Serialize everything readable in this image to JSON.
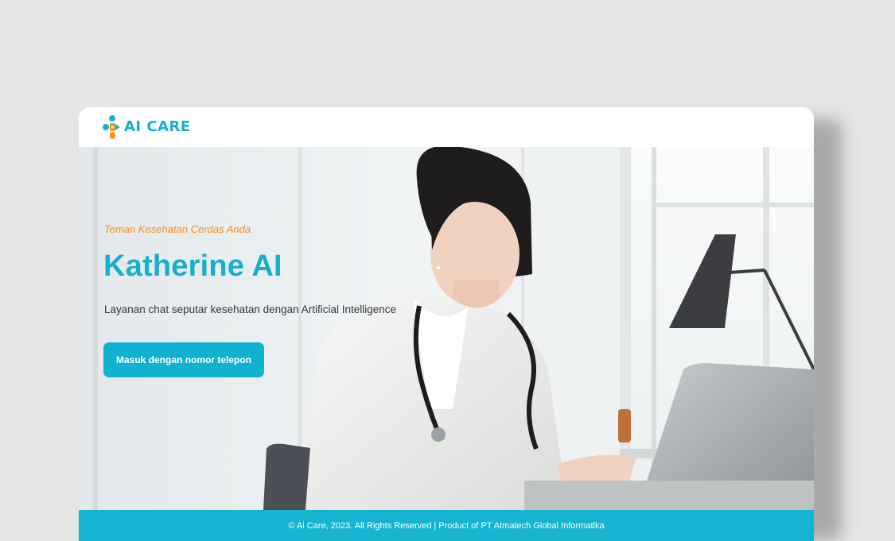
{
  "brand": {
    "name": "AI CARE",
    "color": "#0fb2cf",
    "icon": "ai-care-logo-icon"
  },
  "hero": {
    "tagline": "Teman Kesehatan Cerdas Anda",
    "title": "Katherine AI",
    "subtitle": "Layanan chat seputar kesehatan dengan Artificial Intelligence",
    "cta_label": "Masuk dengan nomor telepon",
    "image": "doctor-with-laptop-photo"
  },
  "footer": {
    "text": "© Ai Care, 2023. All Rights Reserved | Product of PT Atmatech Global Informatika"
  },
  "colors": {
    "accent": "#0fb2cf",
    "tagline": "#f7901e",
    "background": "#e6e6e6"
  }
}
